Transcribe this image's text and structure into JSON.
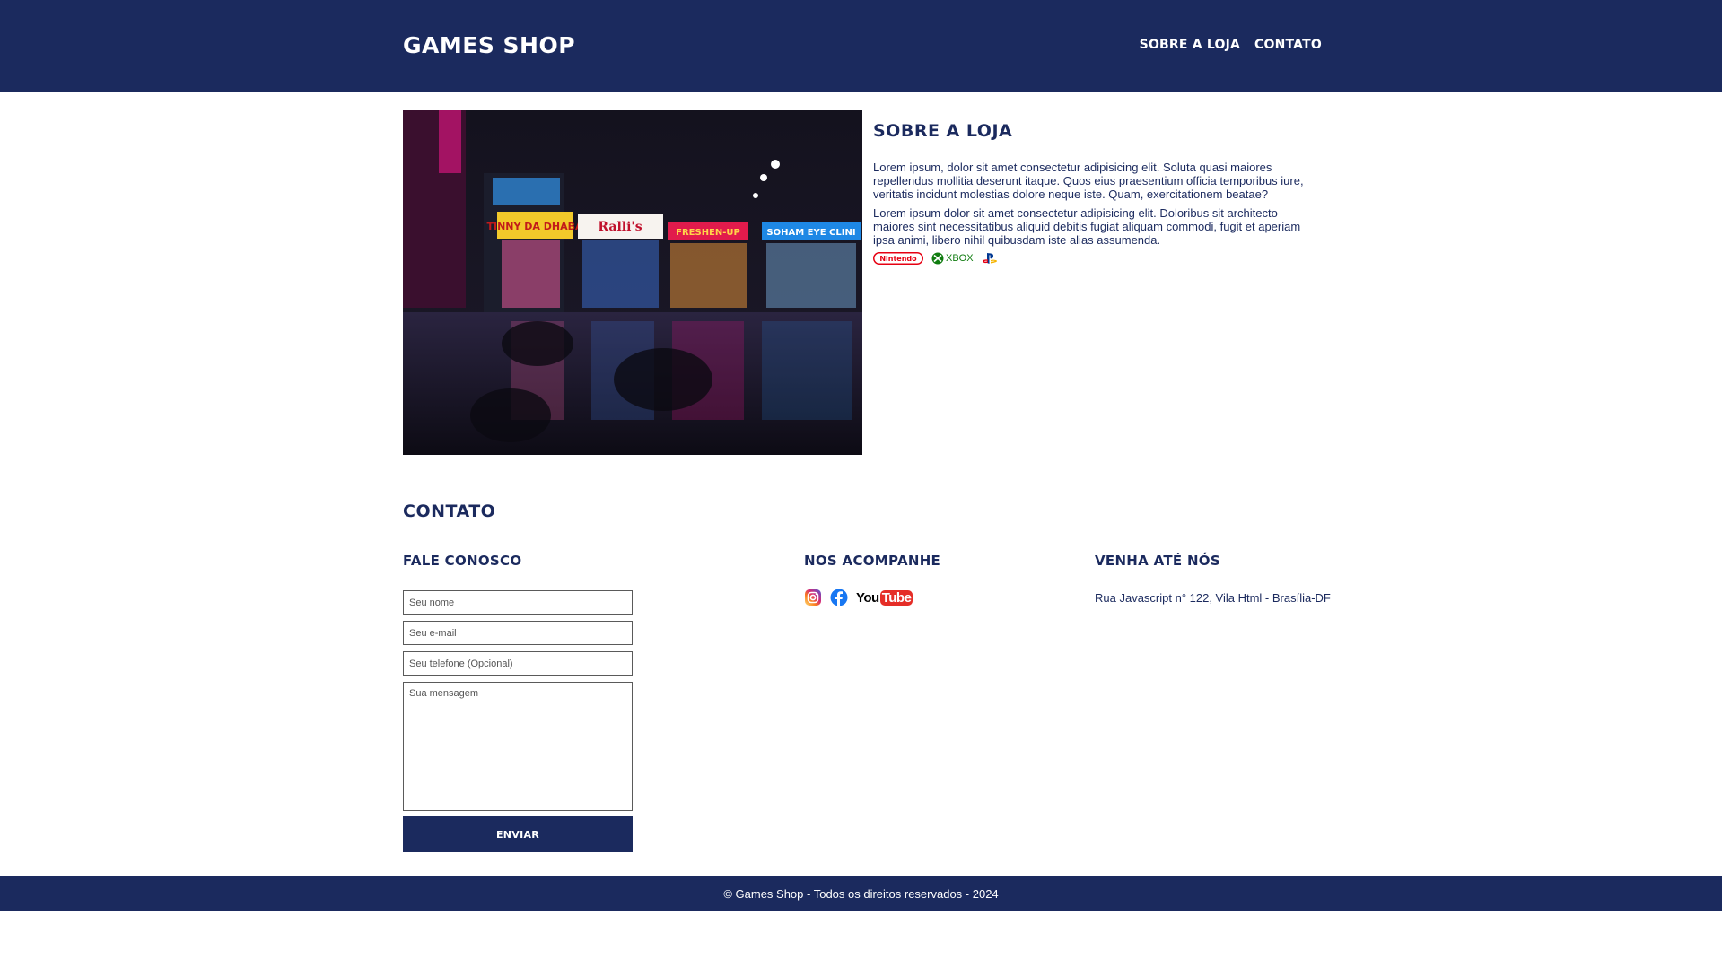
{
  "header": {
    "brand": "Games Shop",
    "nav": [
      {
        "label": "Sobre a loja"
      },
      {
        "label": "Contato"
      }
    ]
  },
  "about": {
    "title": "Sobre a loja",
    "paragraphs": [
      "Lorem ipsum, dolor sit amet consectetur adipisicing elit. Soluta quasi maiores repellendus mollitia deserunt itaque. Quos eius praesentium officia temporibus iure, veritatis incidunt molestias dolore neque iste. Quam, exercitationem beatae?",
      "Lorem ipsum dolor sit amet consectetur adipisicing elit. Doloribus sit architecto maiores sint necessitatibus aliquid debitis fugiat aliquam commodi, fugit et aperiam ipsa animi, libero nihil quibusdam iste alias assumenda."
    ],
    "brands": {
      "nintendo": "Nintendo",
      "xbox": "XBOX"
    },
    "photo_signs": [
      "TINNY DA DHABA",
      "Ralli's",
      "FRESHEN-UP",
      "SOHAM EYE CLINI"
    ]
  },
  "contact": {
    "title": "Contato",
    "form": {
      "title": "Fale conosco",
      "name_placeholder": "Seu nome",
      "email_placeholder": "Seu e-mail",
      "phone_placeholder": "Seu telefone (Opcional)",
      "message_placeholder": "Sua mensagem",
      "submit_label": "Enviar"
    },
    "social": {
      "title": "Nos acompanhe",
      "youtube_you": "You",
      "youtube_tube": "Tube"
    },
    "visit": {
      "title": "Venha até nós",
      "address": "Rua Javascript n° 122, Vila Html - Brasília-DF"
    }
  },
  "footer": {
    "text": "© Games Shop - Todos os direitos reservados - 2024"
  },
  "colors": {
    "primary": "#1b2a5e",
    "nintendo_red": "#e60012",
    "xbox_green": "#107c10",
    "facebook_blue": "#1877f2",
    "youtube_red": "#ff0000"
  }
}
